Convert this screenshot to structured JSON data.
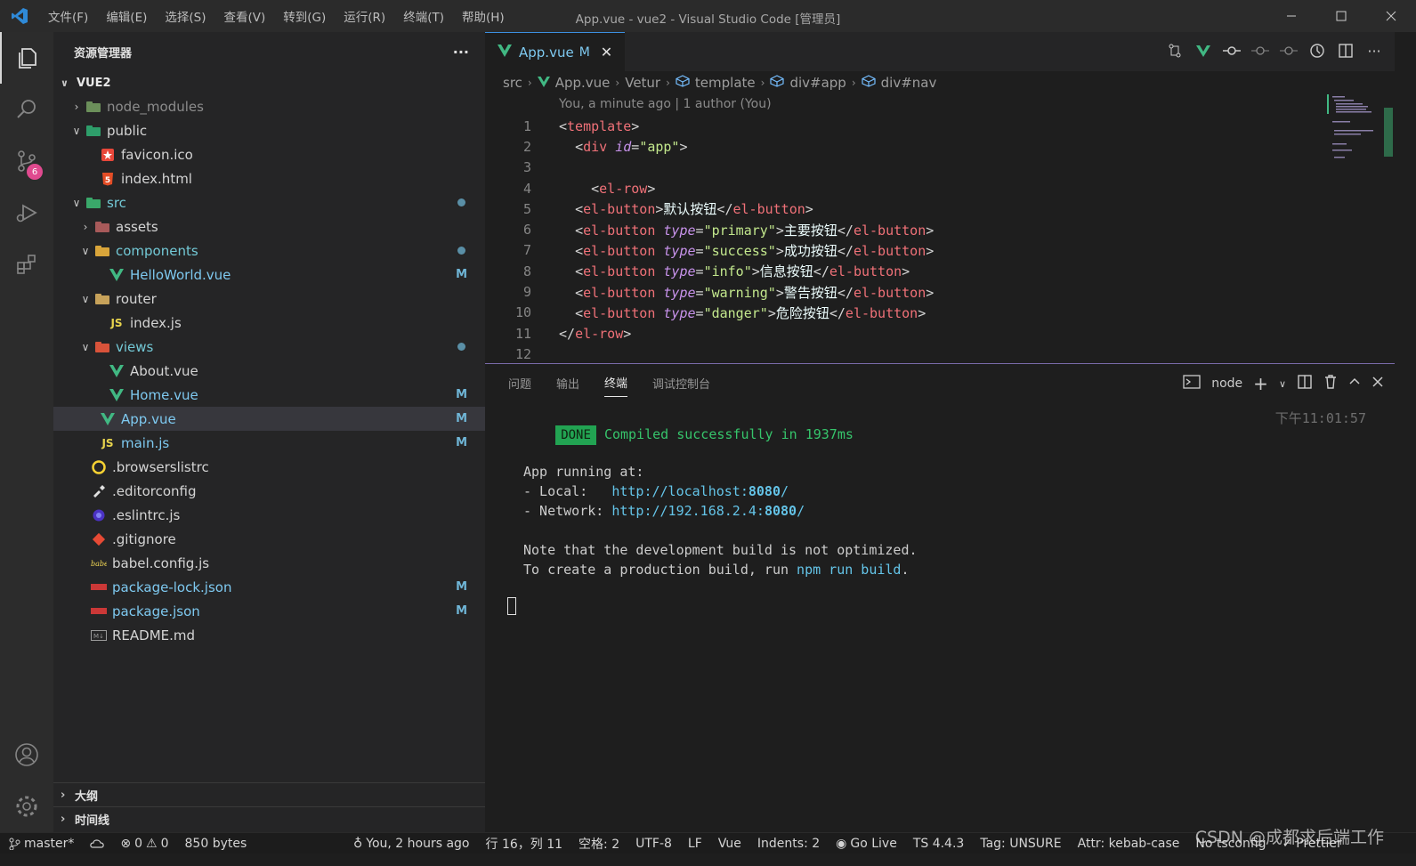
{
  "titlebar": {
    "menu": [
      "文件(F)",
      "编辑(E)",
      "选择(S)",
      "查看(V)",
      "转到(G)",
      "运行(R)",
      "终端(T)",
      "帮助(H)"
    ],
    "title": "App.vue - vue2 - Visual Studio Code [管理员]"
  },
  "activity": {
    "scm_badge": "6"
  },
  "sidebar": {
    "header": "资源管理器",
    "more": "···",
    "root": "VUE2",
    "items": [
      {
        "label": "node_modules",
        "status": "",
        "dot": false
      },
      {
        "label": "public",
        "status": "",
        "dot": false
      },
      {
        "label": "favicon.ico",
        "status": "",
        "dot": false
      },
      {
        "label": "index.html",
        "status": "",
        "dot": false
      },
      {
        "label": "src",
        "status": "",
        "dot": true
      },
      {
        "label": "assets",
        "status": "",
        "dot": false
      },
      {
        "label": "components",
        "status": "",
        "dot": true
      },
      {
        "label": "HelloWorld.vue",
        "status": "M",
        "dot": false
      },
      {
        "label": "router",
        "status": "",
        "dot": false
      },
      {
        "label": "index.js",
        "status": "",
        "dot": false
      },
      {
        "label": "views",
        "status": "",
        "dot": true
      },
      {
        "label": "About.vue",
        "status": "",
        "dot": false
      },
      {
        "label": "Home.vue",
        "status": "M",
        "dot": false
      },
      {
        "label": "App.vue",
        "status": "M",
        "dot": false
      },
      {
        "label": "main.js",
        "status": "M",
        "dot": false
      },
      {
        "label": ".browserslistrc",
        "status": "",
        "dot": false
      },
      {
        "label": ".editorconfig",
        "status": "",
        "dot": false
      },
      {
        "label": ".eslintrc.js",
        "status": "",
        "dot": false
      },
      {
        "label": ".gitignore",
        "status": "",
        "dot": false
      },
      {
        "label": "babel.config.js",
        "status": "",
        "dot": false
      },
      {
        "label": "package-lock.json",
        "status": "M",
        "dot": false
      },
      {
        "label": "package.json",
        "status": "M",
        "dot": false
      },
      {
        "label": "README.md",
        "status": "",
        "dot": false
      }
    ],
    "outline": "大纲",
    "timeline": "时间线"
  },
  "editor": {
    "tab": {
      "label": "App.vue",
      "status": "M",
      "close": "✕"
    },
    "breadcrumb": [
      "src",
      "App.vue",
      "Vetur",
      "template",
      "div#app",
      "div#nav"
    ],
    "blame": "You, a minute ago | 1 author (You)",
    "line_numbers": [
      "1",
      "2",
      "3",
      "4",
      "5",
      "6",
      "7",
      "8",
      "9",
      "10",
      "11",
      "12"
    ],
    "code": {
      "l1_tag": "template",
      "l2_tag": "div",
      "l2_attr": "id",
      "l2_val": "\"app\"",
      "l4_tag": "el-row",
      "l5_tag": "el-button",
      "l5_text": "默认按钮",
      "l6_tag": "el-button",
      "l6_attr": "type",
      "l6_val": "\"primary\"",
      "l6_text": "主要按钮",
      "l7_tag": "el-button",
      "l7_attr": "type",
      "l7_val": "\"success\"",
      "l7_text": "成功按钮",
      "l8_tag": "el-button",
      "l8_attr": "type",
      "l8_val": "\"info\"",
      "l8_text": "信息按钮",
      "l9_tag": "el-button",
      "l9_attr": "type",
      "l9_val": "\"warning\"",
      "l9_text": "警告按钮",
      "l10_tag": "el-button",
      "l10_attr": "type",
      "l10_val": "\"danger\"",
      "l10_text": "危险按钮",
      "l11_tag": "el-row"
    }
  },
  "panel": {
    "tabs": [
      "问题",
      "输出",
      "终端",
      "调试控制台"
    ],
    "terminal_name": "node",
    "done": "DONE",
    "compiled": "Compiled successfully in 1937ms",
    "time": "下午11:01:57",
    "app_running": "App running at:",
    "local_label": "- Local:   ",
    "local_url_a": "http://localhost:",
    "local_port": "8080",
    "local_url_b": "/",
    "network_label": "- Network: ",
    "network_url_a": "http://192.168.2.4:",
    "network_port": "8080",
    "network_url_b": "/",
    "note1": "Note that the development build is not optimized.",
    "note2_a": "To create a production build, run ",
    "note2_cmd": "npm run build",
    "note2_b": "."
  },
  "statusbar": {
    "branch": "master*",
    "errors": "0",
    "warnings": "0",
    "size": "850 bytes",
    "blame": "You, 2 hours ago",
    "position": "行 16，列 11",
    "spaces": "空格: 2",
    "encoding": "UTF-8",
    "eol": "LF",
    "language": "Vue",
    "indents": "Indents: 2",
    "golive": "Go Live",
    "ts": "TS 4.4.3",
    "tag": "Tag: UNSURE",
    "attr": "Attr: kebab-case",
    "tsconfig": "No tsconfig",
    "prettier": "Prettier"
  },
  "watermark": "CSDN @成都求后端工作"
}
